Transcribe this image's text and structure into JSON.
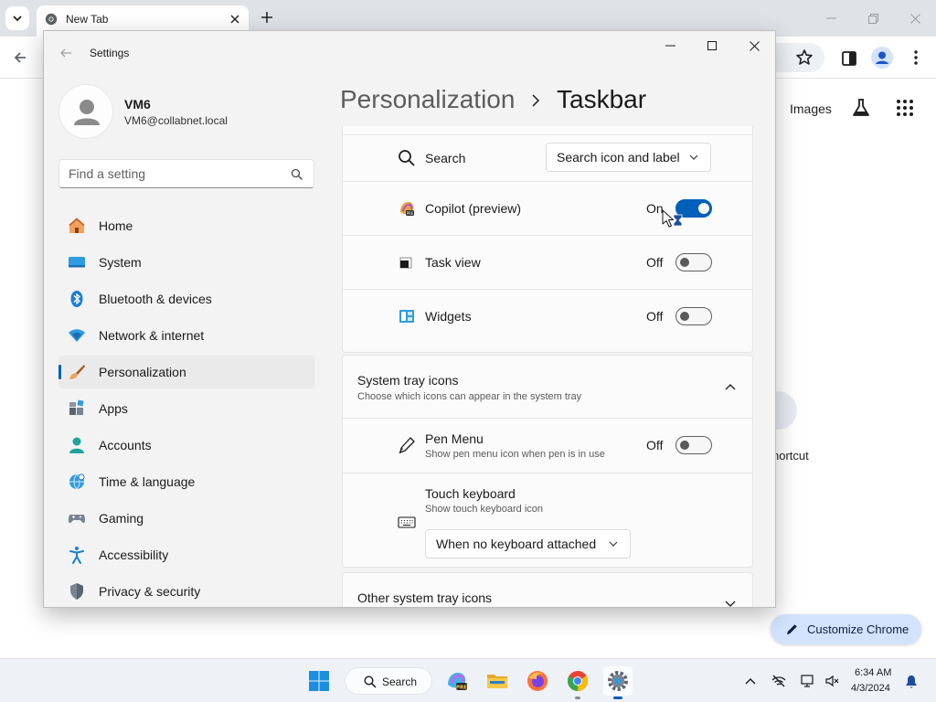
{
  "chrome": {
    "tab_title": "New Tab",
    "images_link": "Images",
    "shortcut_label": "hortcut",
    "customize_label": "Customize Chrome"
  },
  "settings": {
    "window_title": "Settings",
    "user": {
      "name": "VM6",
      "email": "VM6@collabnet.local"
    },
    "search": {
      "placeholder": "Find a setting"
    },
    "nav": [
      {
        "label": "Home",
        "icon": "home-icon"
      },
      {
        "label": "System",
        "icon": "system-icon"
      },
      {
        "label": "Bluetooth & devices",
        "icon": "bluetooth-icon"
      },
      {
        "label": "Network & internet",
        "icon": "network-icon"
      },
      {
        "label": "Personalization",
        "icon": "personalization-brush-icon",
        "selected": true
      },
      {
        "label": "Apps",
        "icon": "apps-icon"
      },
      {
        "label": "Accounts",
        "icon": "accounts-icon"
      },
      {
        "label": "Time & language",
        "icon": "time-language-icon"
      },
      {
        "label": "Gaming",
        "icon": "gaming-icon"
      },
      {
        "label": "Accessibility",
        "icon": "accessibility-icon"
      },
      {
        "label": "Privacy & security",
        "icon": "privacy-shield-icon"
      }
    ],
    "breadcrumb": {
      "parent": "Personalization",
      "current": "Taskbar"
    },
    "taskbar_items": {
      "search": {
        "label": "Search",
        "value": "Search icon and label"
      },
      "copilot": {
        "label": "Copilot (preview)",
        "state": "On",
        "on": true
      },
      "task_view": {
        "label": "Task view",
        "state": "Off",
        "on": false
      },
      "widgets": {
        "label": "Widgets",
        "state": "Off",
        "on": false
      }
    },
    "system_tray": {
      "title": "System tray icons",
      "subtitle": "Choose which icons can appear in the system tray",
      "pen_menu": {
        "label": "Pen Menu",
        "sub": "Show pen menu icon when pen is in use",
        "state": "Off",
        "on": false
      },
      "touch_keyboard": {
        "label": "Touch keyboard",
        "sub": "Show touch keyboard icon",
        "value": "When no keyboard attached"
      }
    },
    "other_tray": {
      "title": "Other system tray icons"
    }
  },
  "taskbar": {
    "search_label": "Search",
    "time": "6:34 AM",
    "date": "4/3/2024"
  },
  "colors": {
    "accent": "#005fb8",
    "window_bg": "#f3f3f3",
    "card_bg": "#fbfbfb",
    "chrome_tabstrip": "#dfe3e7",
    "customize_bg": "#d3e3fd"
  }
}
